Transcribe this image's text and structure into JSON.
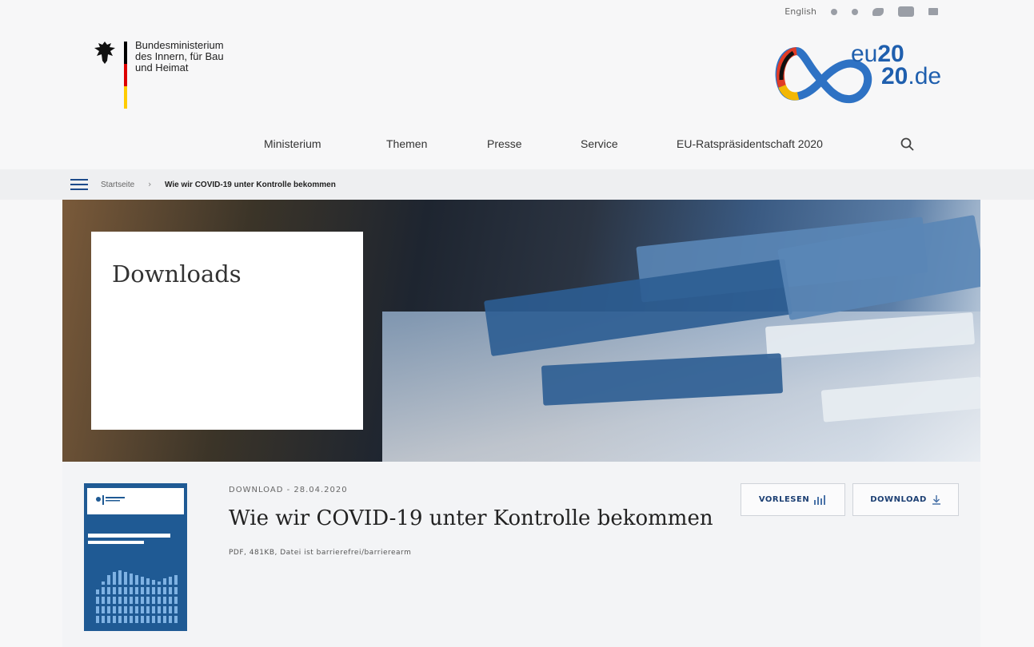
{
  "utility": {
    "language": "English",
    "icons": [
      "gebaerdensprache-icon",
      "leichte-sprache-icon",
      "twitter-icon",
      "youtube-icon",
      "newsletter-icon"
    ]
  },
  "logo": {
    "lines": [
      "Bundesministerium",
      "des Innern, für Bau",
      "und Heimat"
    ],
    "flag_colors": [
      "#000000",
      "#dd0000",
      "#ffcc00"
    ]
  },
  "eu_presidency": {
    "text_top": "eu",
    "text_top_bold": "20",
    "text_bottom_bold": "20",
    "text_bottom": ".de"
  },
  "nav": {
    "items": [
      "Ministerium",
      "Themen",
      "Presse",
      "Service",
      "EU-Ratspräsidentschaft 2020"
    ]
  },
  "breadcrumb": {
    "home": "Startseite",
    "separator": "›",
    "current": "Wie wir COVID-19 unter Kontrolle bekommen"
  },
  "hero": {
    "title": "Downloads"
  },
  "download": {
    "meta": "DOWNLOAD - 28.04.2020",
    "title": "Wie wir COVID-19 unter Kontrolle bekommen",
    "info": "PDF, 481KB, Datei ist barrierefrei/barrierearm",
    "read_label": "VORLESEN",
    "download_label": "DOWNLOAD"
  },
  "colors": {
    "accent": "#1c3f73",
    "brand_blue": "#1f5a94"
  }
}
